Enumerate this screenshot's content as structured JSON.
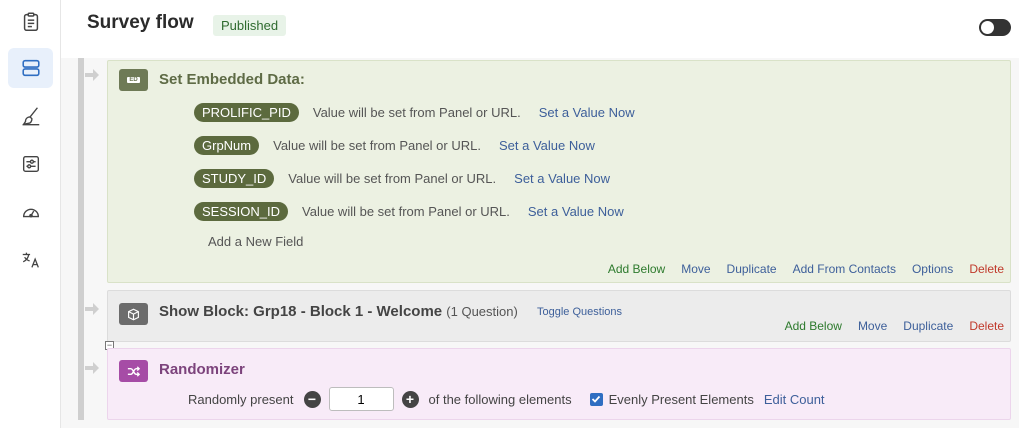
{
  "sidebar": {
    "items": [
      {
        "icon": "clipboard-icon"
      },
      {
        "icon": "survey-flow-icon",
        "active": true
      },
      {
        "icon": "brush-icon"
      },
      {
        "icon": "sliders-icon"
      },
      {
        "icon": "gauge-icon"
      },
      {
        "icon": "translate-icon"
      }
    ]
  },
  "header": {
    "title": "Survey flow",
    "status_badge": "Published"
  },
  "embedded_data": {
    "title": "Set Embedded Data:",
    "icon_text": "ED",
    "fields": [
      {
        "name": "PROLIFIC_PID",
        "note": "Value will be set from Panel or URL.",
        "action": "Set a Value Now"
      },
      {
        "name": "GrpNum",
        "note": "Value will be set from Panel or URL.",
        "action": "Set a Value Now"
      },
      {
        "name": "STUDY_ID",
        "note": "Value will be set from Panel or URL.",
        "action": "Set a Value Now"
      },
      {
        "name": "SESSION_ID",
        "note": "Value will be set from Panel or URL.",
        "action": "Set a Value Now"
      }
    ],
    "add_field": "Add a New Field",
    "actions": {
      "add_below": "Add Below",
      "move": "Move",
      "duplicate": "Duplicate",
      "add_from_contacts": "Add From Contacts",
      "options": "Options",
      "delete": "Delete"
    }
  },
  "show_block": {
    "title": "Show Block: Grp18 - Block 1 - Welcome",
    "question_count": "(1 Question)",
    "toggle_questions": "Toggle Questions",
    "actions": {
      "add_below": "Add Below",
      "move": "Move",
      "duplicate": "Duplicate",
      "delete": "Delete"
    }
  },
  "randomizer": {
    "title": "Randomizer",
    "randomly_present": "Randomly present",
    "count": "1",
    "of_following": "of the following elements",
    "evenly_present": "Evenly Present Elements",
    "edit_count": "Edit Count"
  },
  "colors": {
    "embed_bg": "#ecf1e2",
    "pill_bg": "#5c6a3e",
    "block_bg": "#ececec",
    "randomizer_bg": "#f8ebf8",
    "link": "#3d5f9a",
    "delete": "#c0392b"
  }
}
